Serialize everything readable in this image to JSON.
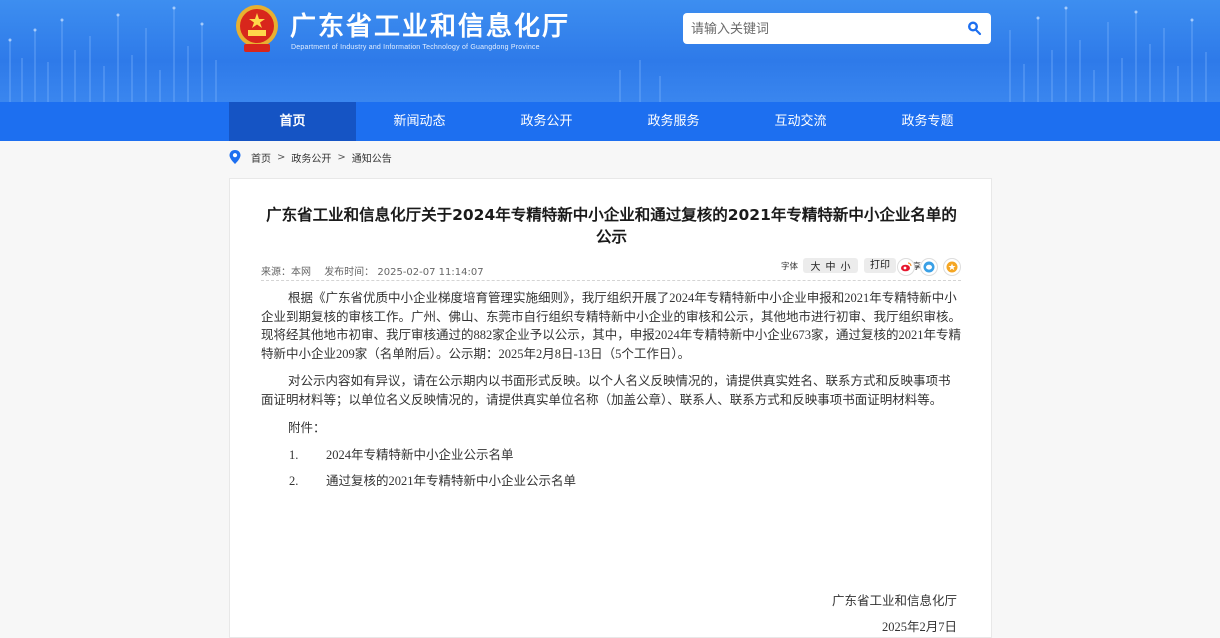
{
  "header": {
    "site_title": "广东省工业和信息化厅",
    "site_subtitle": "Department of Industry and Information Technology of Guangdong Province",
    "search_placeholder": "请输入关键词",
    "search_icon": "search-icon",
    "emblem_icon": "national-emblem-icon"
  },
  "nav": {
    "items": [
      {
        "label": "首页",
        "active": true
      },
      {
        "label": "新闻动态"
      },
      {
        "label": "政务公开"
      },
      {
        "label": "政务服务"
      },
      {
        "label": "互动交流"
      },
      {
        "label": "政务专题"
      }
    ]
  },
  "breadcrumb": {
    "icon": "location-pin-icon",
    "items": [
      "首页",
      "政务公开",
      "通知公告"
    ],
    "separator": ">"
  },
  "article": {
    "title": "广东省工业和信息化厅关于2024年专精特新中小企业和通过复核的2021年专精特新中小企业名单的公示",
    "source": "来源：本网",
    "published": "发布时间： 2025-02-07 11:14:07",
    "font_label": "字体",
    "font_sizes": [
      "大",
      "中",
      "小"
    ],
    "print_label": "打印",
    "share_label": "分享",
    "share_icons": [
      "weibo-icon",
      "wechat-icon",
      "star-icon"
    ],
    "paragraphs": [
      "根据《广东省优质中小企业梯度培育管理实施细则》，我厅组织开展了2024年专精特新中小企业申报和2021年专精特新中小企业到期复核的审核工作。广州、佛山、东莞市自行组织专精特新中小企业的审核和公示，其他地市进行初审、我厅组织审核。现将经其他地市初审、我厅审核通过的882家企业予以公示，其中，申报2024年专精特新中小企业673家，通过复核的2021年专精特新中小企业209家（名单附后）。公示期：2025年2月8日-13日（5个工作日）。",
      "对公示内容如有异议，请在公示期内以书面形式反映。以个人名义反映情况的，请提供真实姓名、联系方式和反映事项书面证明材料等；以单位名义反映情况的，请提供真实单位名称（加盖公章）、联系人、联系方式和反映事项书面证明材料等。"
    ],
    "attachments_label": "附件：",
    "attachments": [
      {
        "num": "1.",
        "name": "2024年专精特新中小企业公示名单"
      },
      {
        "num": "2.",
        "name": "通过复核的2021年专精特新中小企业公示名单"
      }
    ],
    "signature": "广东省工业和信息化厅",
    "signature_date": "2025年2月7日"
  },
  "colors": {
    "header_blue": "#2e7ae9",
    "nav_blue": "#1d6ff0",
    "nav_active": "#1554c4"
  }
}
